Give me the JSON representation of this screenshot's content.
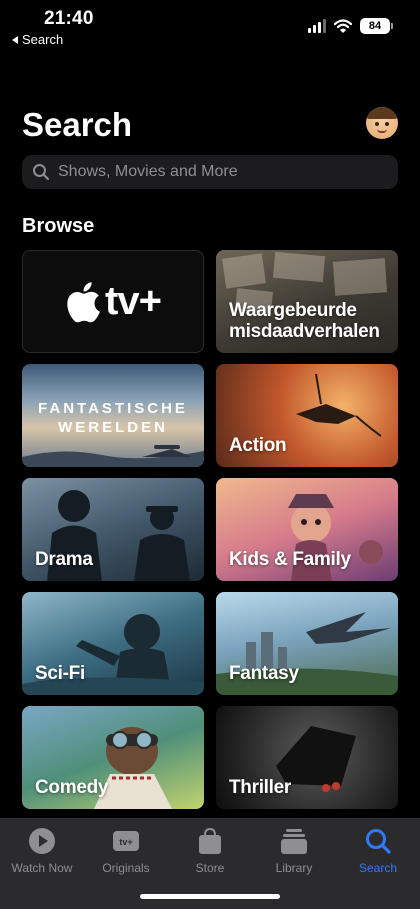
{
  "status_bar": {
    "time": "21:40",
    "back_label": "Search",
    "battery": "84"
  },
  "header": {
    "title": "Search"
  },
  "search": {
    "placeholder": "Shows, Movies and More"
  },
  "browse": {
    "title": "Browse",
    "tiles": [
      {
        "label": "tv+",
        "brand": "apple-logo"
      },
      {
        "label": "Waargebeurde misdaadverhalen"
      },
      {
        "label": "FANTASTISCHE\nWERELDEN"
      },
      {
        "label": "Action"
      },
      {
        "label": "Drama"
      },
      {
        "label": "Kids & Family"
      },
      {
        "label": "Sci-Fi"
      },
      {
        "label": "Fantasy"
      },
      {
        "label": "Comedy"
      },
      {
        "label": "Thriller"
      }
    ]
  },
  "tabbar": {
    "tabs": [
      {
        "label": "Watch Now",
        "icon": "play-circle-icon"
      },
      {
        "label": "Originals",
        "icon": "appletv-icon"
      },
      {
        "label": "Store",
        "icon": "bag-icon"
      },
      {
        "label": "Library",
        "icon": "stack-icon"
      },
      {
        "label": "Search",
        "icon": "search-icon",
        "active": true
      }
    ]
  },
  "colors": {
    "accent": "#2f7bf5",
    "background": "#000000",
    "field": "#1c1c1e"
  }
}
